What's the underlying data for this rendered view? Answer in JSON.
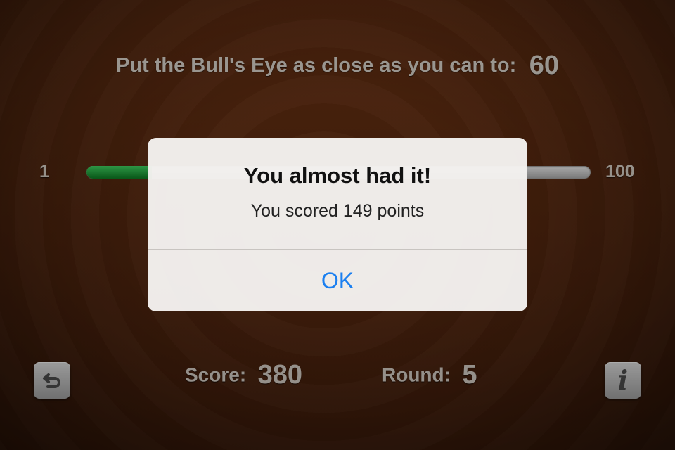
{
  "game": {
    "target_label": "Put the Bull's Eye as close as you can to:",
    "target_value": "60",
    "slider": {
      "min_label": "1",
      "max_label": "100",
      "current_fraction": 0.13,
      "fill_color": "#1fa83a"
    },
    "score_label": "Score:",
    "score_value": "380",
    "round_label": "Round:",
    "round_value": "5",
    "restart_icon": "undo-arrow-icon",
    "info_icon": "info-icon"
  },
  "alert": {
    "title": "You almost had it!",
    "message": "You scored 149 points",
    "ok_label": "OK",
    "ok_color": "#1a7ff0"
  }
}
